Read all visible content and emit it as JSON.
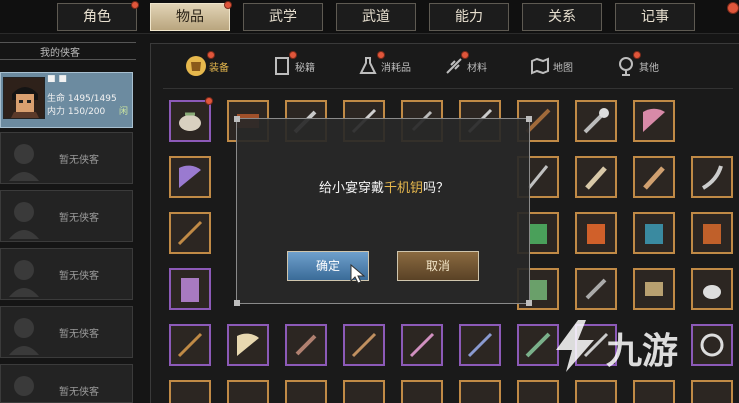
{
  "top_tabs": [
    {
      "label": "角色",
      "dot": true
    },
    {
      "label": "物品",
      "dot": true,
      "active": true
    },
    {
      "label": "武学",
      "dot": false
    },
    {
      "label": "武道",
      "dot": false
    },
    {
      "label": "能力",
      "dot": false
    },
    {
      "label": "关系",
      "dot": false
    },
    {
      "label": "记事",
      "dot": false
    }
  ],
  "party": {
    "header": "我的侠客",
    "active_member": {
      "name_badge": "■ ■",
      "hp_label": "生命 1495/1495",
      "mp_label": "内力 150/200",
      "tag": "闲"
    },
    "empty_label": "暂无侠客"
  },
  "inventory_tabs": [
    {
      "label": "装备",
      "icon": "armor-icon",
      "active": true
    },
    {
      "label": "秘籍",
      "icon": "book-icon"
    },
    {
      "label": "消耗品",
      "icon": "potion-icon"
    },
    {
      "label": "材料",
      "icon": "herb-icon"
    },
    {
      "label": "地图",
      "icon": "map-icon"
    },
    {
      "label": "其他",
      "icon": "bell-icon"
    }
  ],
  "dialog": {
    "prefix": "给小宴穿戴",
    "item_name": "千机钥",
    "suffix": "吗？",
    "confirm": "确定",
    "cancel": "取消"
  },
  "watermark": {
    "text": "九游"
  },
  "colors": {
    "accent_gold": "#e6b84d",
    "frame_orange": "#c08a46",
    "frame_purple": "#8c5ab8",
    "confirm_blue": "#4a7fb0"
  }
}
